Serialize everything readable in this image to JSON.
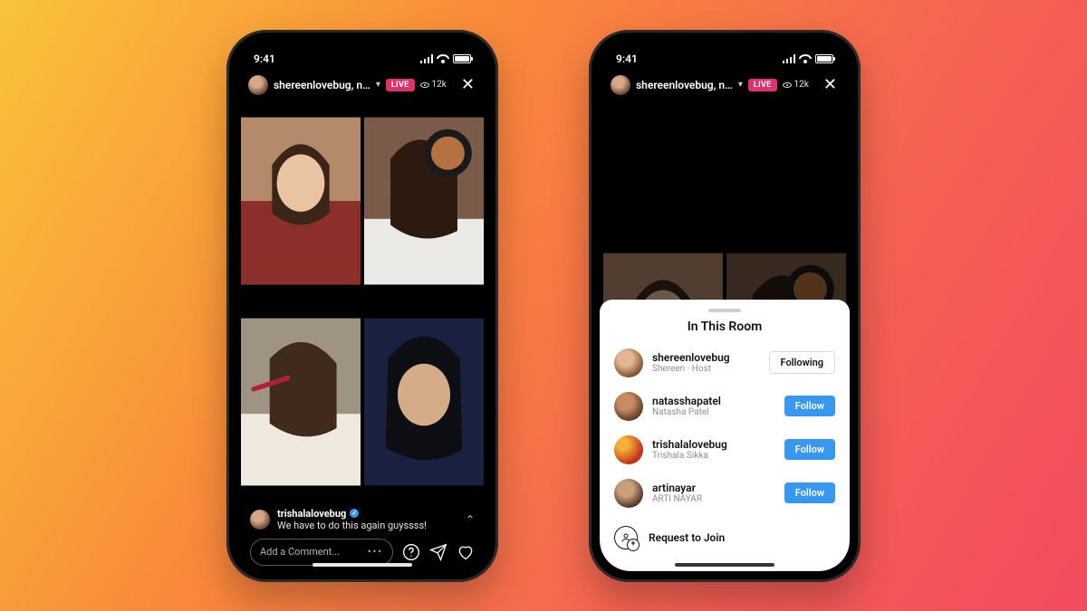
{
  "status": {
    "time": "9:41"
  },
  "live": {
    "host_username": "shereenlovebug, n…",
    "badge": "LIVE",
    "viewer_count": "12k"
  },
  "comment": {
    "username": "trishalalovebug",
    "text": "We have to do this again guyssss!"
  },
  "input": {
    "placeholder": "Add a Comment...",
    "more": "•••"
  },
  "sheet": {
    "title": "In This Room",
    "members": [
      {
        "username": "shereenlovebug",
        "subtitle": "Shereen · Host",
        "action": "Following"
      },
      {
        "username": "natasshapatel",
        "subtitle": "Natasha Patel",
        "action": "Follow"
      },
      {
        "username": "trishalalovebug",
        "subtitle": "Trishala Sikka",
        "action": "Follow"
      },
      {
        "username": "artinayar",
        "subtitle": "ARTI NAYAR",
        "action": "Follow"
      }
    ],
    "request_label": "Request to Join"
  }
}
